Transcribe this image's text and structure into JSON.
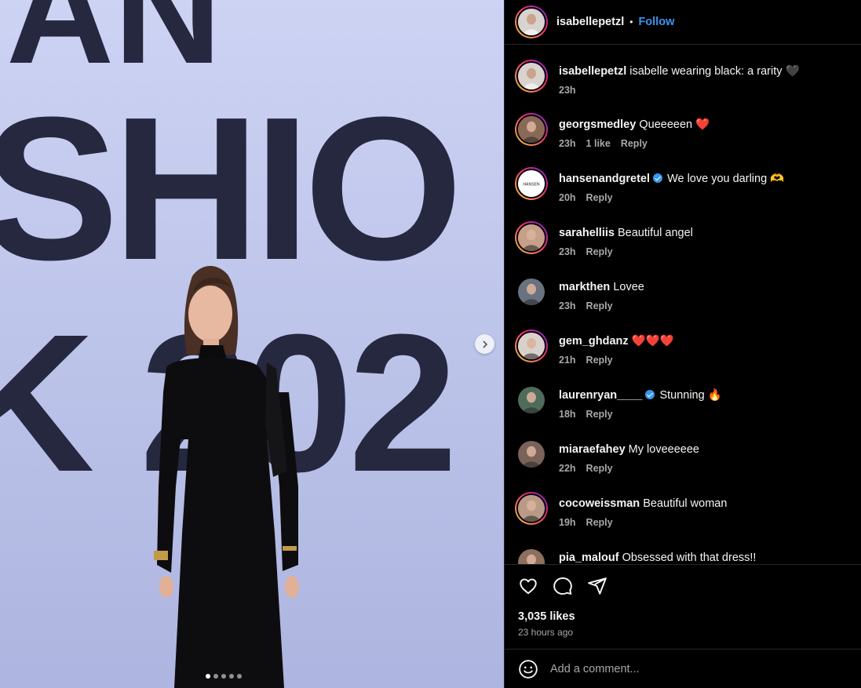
{
  "post": {
    "author": "isabellepetzl",
    "follow_label": "Follow",
    "separator": "•",
    "banner_letters": {
      "row1": "AN",
      "row2": "SHIO",
      "row3": "K 202"
    },
    "carousel": {
      "total": 5,
      "active": 0
    }
  },
  "caption": {
    "user": "isabellepetzl",
    "text": "isabelle wearing black: a rarity",
    "emoji": "🖤",
    "time": "23h"
  },
  "comments": [
    {
      "user": "georgsmedley",
      "text": "Queeeeen",
      "emoji": "❤️",
      "time": "23h",
      "likes": "1 like",
      "reply": "Reply",
      "verified": false,
      "avatar_ring": true,
      "avatar_color": "#8a6a55"
    },
    {
      "user": "hansenandgretel",
      "text": "We love you darling",
      "emoji": "🫶",
      "time": "20h",
      "likes": "",
      "reply": "Reply",
      "verified": true,
      "avatar_ring": true,
      "avatar_color": "#ffffff",
      "avatar_text": "HANSEN"
    },
    {
      "user": "sarahelliis",
      "text": "Beautiful angel",
      "emoji": "",
      "time": "23h",
      "likes": "",
      "reply": "Reply",
      "verified": false,
      "avatar_ring": true,
      "avatar_color": "#c7a08a"
    },
    {
      "user": "markthen",
      "text": "Lovee",
      "emoji": "",
      "time": "23h",
      "likes": "",
      "reply": "Reply",
      "verified": false,
      "avatar_ring": false,
      "avatar_color": "#6a7280"
    },
    {
      "user": "gem_ghdanz",
      "text": "",
      "emoji": "❤️❤️❤️",
      "time": "21h",
      "likes": "",
      "reply": "Reply",
      "verified": false,
      "avatar_ring": true,
      "avatar_color": "#d9d2cc"
    },
    {
      "user": "laurenryan____",
      "text": "Stunning",
      "emoji": "🔥",
      "time": "18h",
      "likes": "",
      "reply": "Reply",
      "verified": true,
      "avatar_ring": false,
      "avatar_color": "#4f6b5a"
    },
    {
      "user": "miaraefahey",
      "text": "My loveeeeee",
      "emoji": "",
      "time": "22h",
      "likes": "",
      "reply": "Reply",
      "verified": false,
      "avatar_ring": false,
      "avatar_color": "#7a6258"
    },
    {
      "user": "cocoweissman",
      "text": "Beautiful woman",
      "emoji": "",
      "time": "19h",
      "likes": "",
      "reply": "Reply",
      "verified": false,
      "avatar_ring": true,
      "avatar_color": "#b89a86"
    },
    {
      "user": "pia_malouf",
      "text": "Obsessed with that dress!!",
      "emoji": "",
      "time": "",
      "likes": "",
      "reply": "",
      "verified": false,
      "avatar_ring": false,
      "avatar_color": "#8d6f5e"
    }
  ],
  "actions": {
    "likes": "3,035 likes",
    "posted_ago": "23 hours ago",
    "icons": [
      "heart-icon",
      "comment-icon",
      "share-icon"
    ]
  },
  "composer": {
    "placeholder": "Add a comment...",
    "emoji_icon": "smiley-icon"
  },
  "colors": {
    "background": "#000000",
    "accent": "#3897f0",
    "muted": "#a8a8a8",
    "divider": "#262626"
  }
}
